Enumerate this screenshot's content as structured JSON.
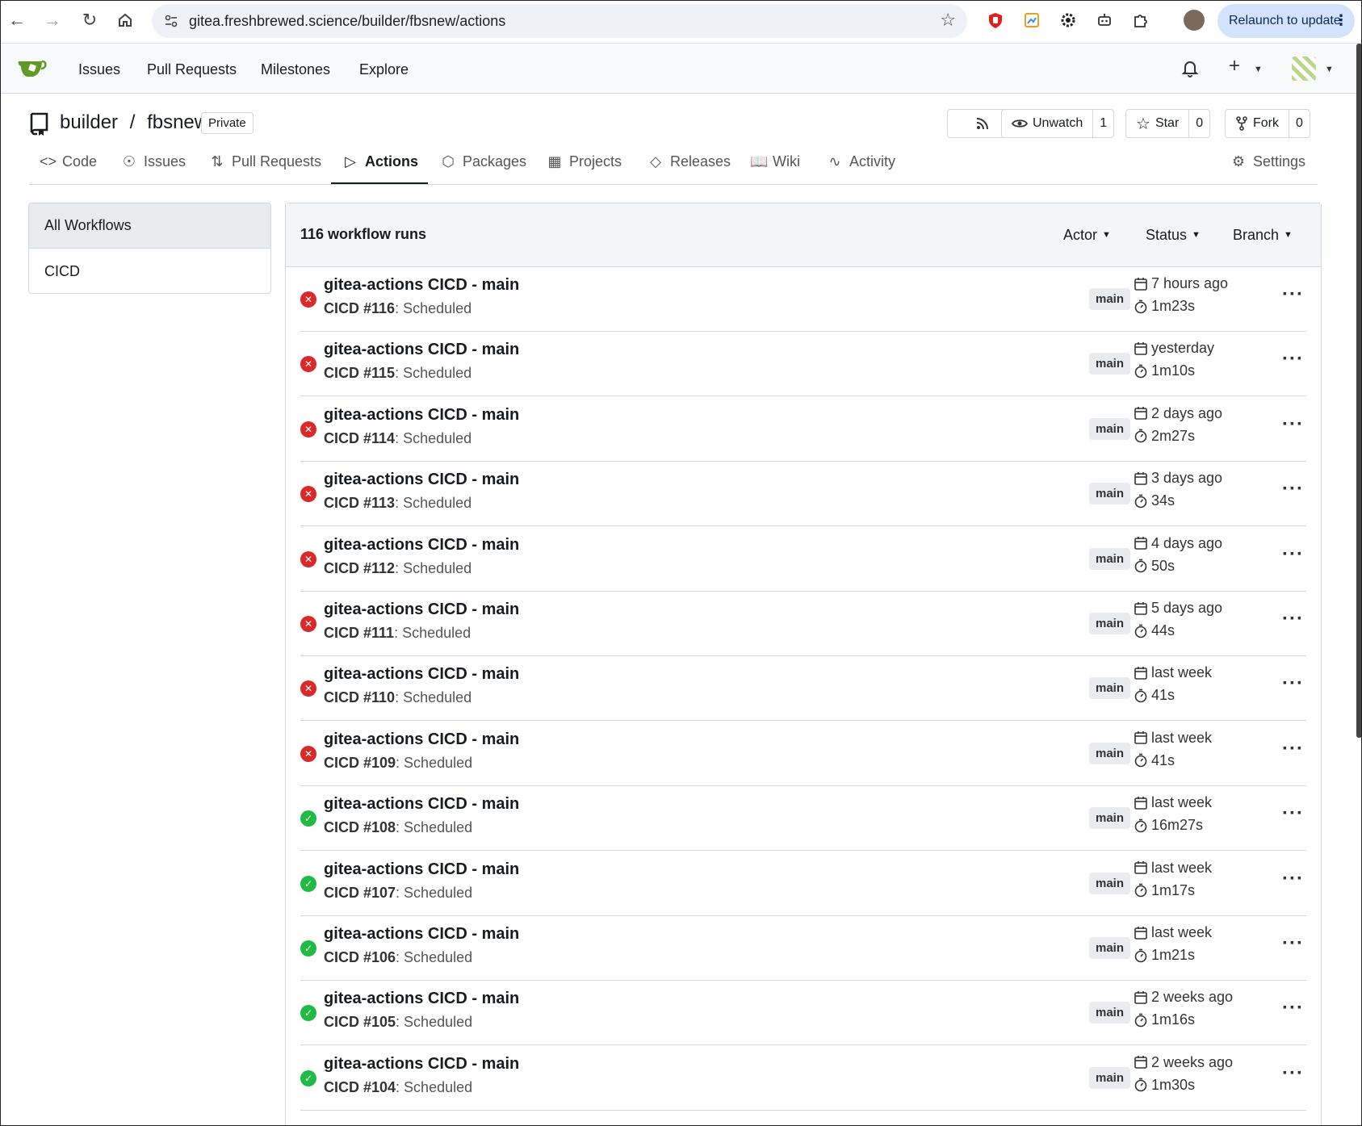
{
  "browser": {
    "url": "gitea.freshbrewed.science/builder/fbsnew/actions",
    "relaunch_label": "Relaunch to update"
  },
  "topnav": {
    "links": [
      "Issues",
      "Pull Requests",
      "Milestones",
      "Explore"
    ]
  },
  "repo": {
    "owner": "builder",
    "separator": "/",
    "name": "fbsnew",
    "visibility": "Private",
    "unwatch_label": "Unwatch",
    "watch_count": "1",
    "star_label": "Star",
    "star_count": "0",
    "fork_label": "Fork",
    "fork_count": "0"
  },
  "tabs": [
    {
      "label": "Code",
      "icon": "code-icon"
    },
    {
      "label": "Issues",
      "icon": "issue-icon"
    },
    {
      "label": "Pull Requests",
      "icon": "pull-request-icon"
    },
    {
      "label": "Actions",
      "icon": "play-icon",
      "active": true
    },
    {
      "label": "Packages",
      "icon": "package-icon"
    },
    {
      "label": "Projects",
      "icon": "project-icon"
    },
    {
      "label": "Releases",
      "icon": "tag-icon"
    },
    {
      "label": "Wiki",
      "icon": "book-icon"
    },
    {
      "label": "Activity",
      "icon": "pulse-icon"
    },
    {
      "label": "Settings",
      "icon": "tools-icon"
    }
  ],
  "sidebar": {
    "items": [
      "All Workflows",
      "CICD"
    ]
  },
  "runs_panel": {
    "count_label": "116 workflow runs",
    "filters": [
      "Actor",
      "Status",
      "Branch"
    ]
  },
  "runs": [
    {
      "title": "gitea-actions CICD - main",
      "workflow": "CICD #116",
      "trigger": ": Scheduled",
      "branch": "main",
      "when": "7 hours ago",
      "duration": "1m23s",
      "status": "failure"
    },
    {
      "title": "gitea-actions CICD - main",
      "workflow": "CICD #115",
      "trigger": ": Scheduled",
      "branch": "main",
      "when": "yesterday",
      "duration": "1m10s",
      "status": "failure"
    },
    {
      "title": "gitea-actions CICD - main",
      "workflow": "CICD #114",
      "trigger": ": Scheduled",
      "branch": "main",
      "when": "2 days ago",
      "duration": "2m27s",
      "status": "failure"
    },
    {
      "title": "gitea-actions CICD - main",
      "workflow": "CICD #113",
      "trigger": ": Scheduled",
      "branch": "main",
      "when": "3 days ago",
      "duration": "34s",
      "status": "failure"
    },
    {
      "title": "gitea-actions CICD - main",
      "workflow": "CICD #112",
      "trigger": ": Scheduled",
      "branch": "main",
      "when": "4 days ago",
      "duration": "50s",
      "status": "failure"
    },
    {
      "title": "gitea-actions CICD - main",
      "workflow": "CICD #111",
      "trigger": ": Scheduled",
      "branch": "main",
      "when": "5 days ago",
      "duration": "44s",
      "status": "failure"
    },
    {
      "title": "gitea-actions CICD - main",
      "workflow": "CICD #110",
      "trigger": ": Scheduled",
      "branch": "main",
      "when": "last week",
      "duration": "41s",
      "status": "failure"
    },
    {
      "title": "gitea-actions CICD - main",
      "workflow": "CICD #109",
      "trigger": ": Scheduled",
      "branch": "main",
      "when": "last week",
      "duration": "41s",
      "status": "failure"
    },
    {
      "title": "gitea-actions CICD - main",
      "workflow": "CICD #108",
      "trigger": ": Scheduled",
      "branch": "main",
      "when": "last week",
      "duration": "16m27s",
      "status": "success"
    },
    {
      "title": "gitea-actions CICD - main",
      "workflow": "CICD #107",
      "trigger": ": Scheduled",
      "branch": "main",
      "when": "last week",
      "duration": "1m17s",
      "status": "success"
    },
    {
      "title": "gitea-actions CICD - main",
      "workflow": "CICD #106",
      "trigger": ": Scheduled",
      "branch": "main",
      "when": "last week",
      "duration": "1m21s",
      "status": "success"
    },
    {
      "title": "gitea-actions CICD - main",
      "workflow": "CICD #105",
      "trigger": ": Scheduled",
      "branch": "main",
      "when": "2 weeks ago",
      "duration": "1m16s",
      "status": "success"
    },
    {
      "title": "gitea-actions CICD - main",
      "workflow": "CICD #104",
      "trigger": ": Scheduled",
      "branch": "main",
      "when": "2 weeks ago",
      "duration": "1m30s",
      "status": "success"
    }
  ],
  "colors": {
    "failure": "#db2828",
    "success": "#21ba45",
    "logo": "#609926"
  }
}
